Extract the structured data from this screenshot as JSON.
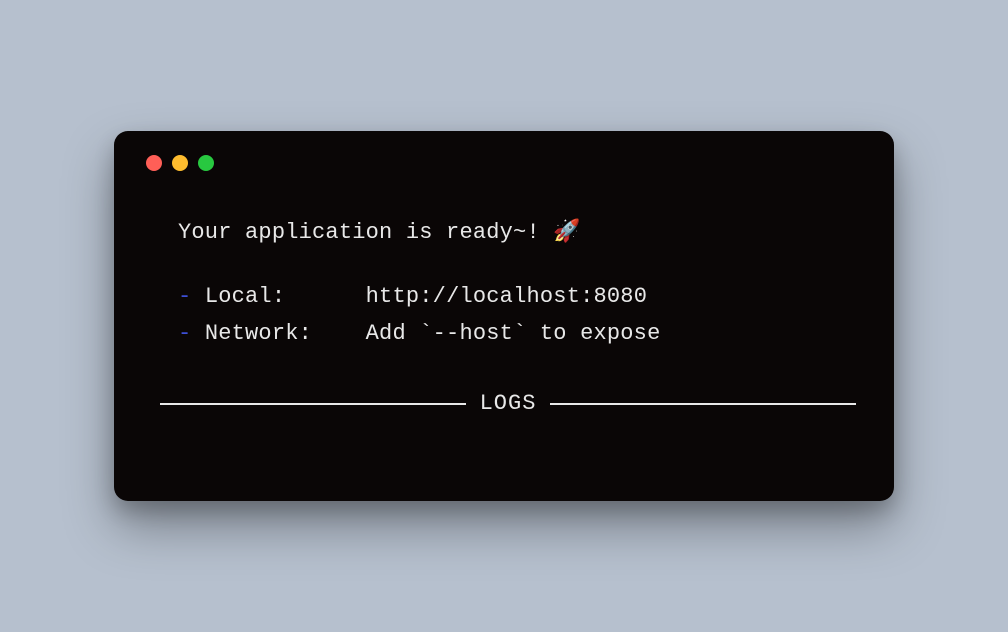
{
  "terminal": {
    "readyMessage": "Your application is ready~! 🚀",
    "entries": [
      {
        "label": "Local:",
        "value": "http://localhost:8080"
      },
      {
        "label": "Network:",
        "value": "Add `--host` to expose"
      }
    ],
    "dividerLabel": "LOGS",
    "dash": "-"
  },
  "colors": {
    "trafficRed": "#ff5f57",
    "trafficYellow": "#febc2e",
    "trafficGreen": "#28c840",
    "dash": "#3d4fd6",
    "background": "#0a0606"
  }
}
